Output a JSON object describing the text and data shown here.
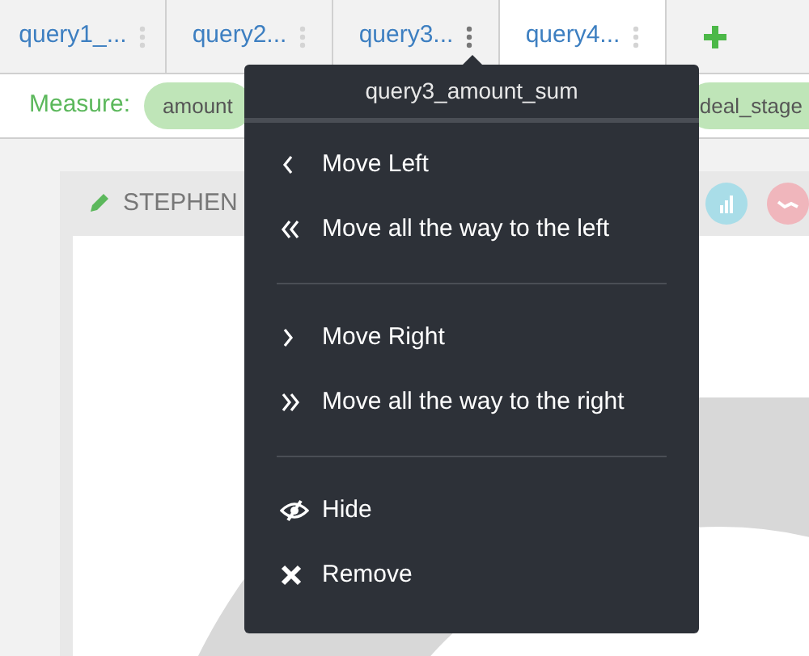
{
  "tabs": [
    {
      "label": "query1_...",
      "selected": false,
      "menu_open": false
    },
    {
      "label": "query2...",
      "selected": false,
      "menu_open": false
    },
    {
      "label": "query3...",
      "selected": false,
      "menu_open": true
    },
    {
      "label": "query4...",
      "selected": true,
      "menu_open": false
    }
  ],
  "measure": {
    "label": "Measure:",
    "pills": [
      "amount",
      "deal_stage"
    ]
  },
  "card": {
    "title": "STEPHEN"
  },
  "menu": {
    "title": "query3_amount_sum",
    "groups": [
      [
        {
          "kind": "left",
          "label": "Move Left"
        },
        {
          "kind": "far_left",
          "label": "Move all the way to the left"
        }
      ],
      [
        {
          "kind": "right",
          "label": "Move Right"
        },
        {
          "kind": "far_right",
          "label": "Move all the way to the right"
        }
      ],
      [
        {
          "kind": "hide",
          "label": "Hide"
        },
        {
          "kind": "remove",
          "label": "Remove"
        }
      ]
    ]
  }
}
